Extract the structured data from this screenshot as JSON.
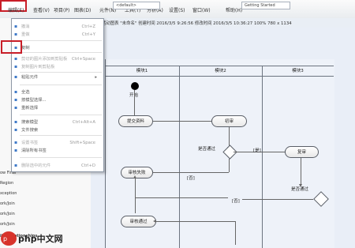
{
  "menu": {
    "items": [
      "编辑(E)",
      "查看(V)",
      "项目(P)",
      "图表(D)",
      "元件(N)",
      "工具(T)",
      "分析(A)",
      "设置(S)",
      "窗口(W)",
      "帮助(H)"
    ],
    "toolbar_default": "<default>",
    "toolbar_getting_started": "Getting Started"
  },
  "tab": {
    "title": "活动图表 \"未命名\" 创建时间 2016/3/5 9:26:56 修改时间 2016/3/5 10:36:27 100% 780 x 1134"
  },
  "dropdown": {
    "items": [
      {
        "label": "撤消",
        "shortcut": "Ctrl+Z",
        "icon": "undo-icon",
        "disabled": true
      },
      {
        "label": "重做",
        "shortcut": "Ctrl+Y",
        "icon": "redo-icon",
        "disabled": true
      },
      {
        "label": "复制",
        "shortcut": "",
        "icon": "copy-icon",
        "disabled": false
      },
      {
        "label": "剪切的图片添加到剪贴板",
        "shortcut": "Ctrl+Space",
        "icon": "cut-icon",
        "disabled": true
      },
      {
        "label": "复制图片到剪贴板",
        "shortcut": "",
        "icon": "image-icon",
        "disabled": true
      },
      {
        "label": "粘贴元件",
        "shortcut": "",
        "icon": "paste-icon",
        "disabled": false
      },
      {
        "label": "全选",
        "shortcut": "",
        "icon": "select-all-icon",
        "disabled": false
      },
      {
        "label": "按模型选择...",
        "shortcut": "",
        "icon": "model-icon",
        "disabled": false
      },
      {
        "label": "重新选择",
        "shortcut": "",
        "icon": "reselect-icon",
        "disabled": false
      },
      {
        "label": "搜索模型",
        "shortcut": "Ctrl+Alt+A",
        "icon": "search-icon",
        "disabled": false
      },
      {
        "label": "文件搜索",
        "shortcut": "",
        "icon": "file-search-icon",
        "disabled": false
      },
      {
        "label": "设置书签",
        "shortcut": "Shift+Space",
        "icon": "bookmark-icon",
        "disabled": true
      },
      {
        "label": "清除所有书签",
        "shortcut": "",
        "icon": "clear-bookmark-icon",
        "disabled": false
      },
      {
        "label": "删除选中的元件",
        "shortcut": "Ctrl+D",
        "icon": "delete-icon",
        "disabled": true
      }
    ]
  },
  "sidebar": {
    "items": [
      "ow Final",
      "Region",
      "xception",
      "ork/Join",
      "ork/Join",
      "ork/Join",
      "ity Relationships"
    ]
  },
  "diagram": {
    "lanes": [
      "模块1",
      "模块2",
      "模块3"
    ],
    "nodes": [
      "提交资料",
      "初审",
      "审核失败",
      "复审",
      "审核通过"
    ],
    "labels": [
      "开始",
      "是否通过",
      "[否]",
      "[是]",
      "[否]",
      "是否通过"
    ]
  },
  "watermark": {
    "text": "php中文网"
  }
}
